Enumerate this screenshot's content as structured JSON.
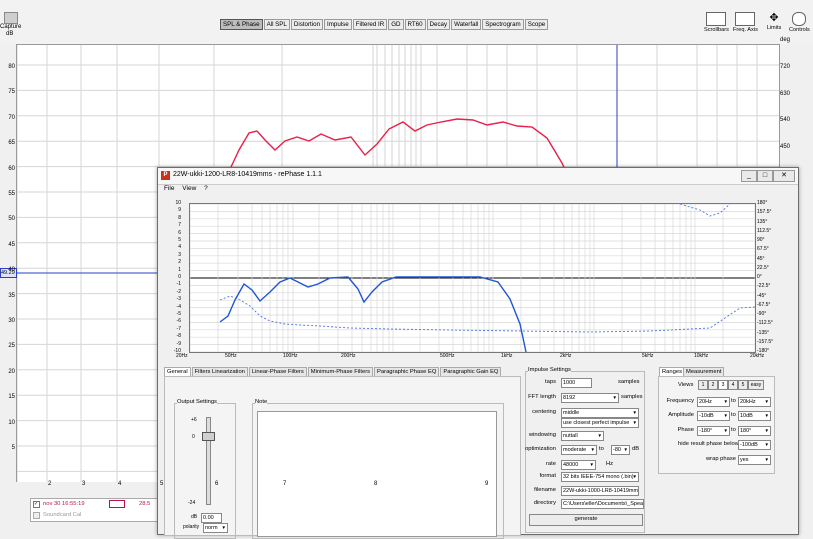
{
  "rew": {
    "capture_label": "Capture",
    "left_unit": "dB",
    "right_unit": "deg",
    "tabs": [
      "SPL & Phase",
      "All SPL",
      "Distortion",
      "Impulse",
      "Filtered IR",
      "GD",
      "RT60",
      "Decay",
      "Waterfall",
      "Spectrogram",
      "Scope"
    ],
    "active_tab": "SPL & Phase",
    "tools": [
      "Scrollbars",
      "Freq. Axis",
      "Limits",
      "Controls"
    ],
    "y_left_ticks": [
      "80",
      "75",
      "70",
      "65",
      "60",
      "55",
      "50",
      "45",
      "40",
      "35",
      "30",
      "25",
      "20",
      "15",
      "10",
      "5"
    ],
    "y_right_ticks": [
      "720",
      "630",
      "540",
      "450"
    ],
    "x_ticks": [
      "2",
      "3",
      "4",
      "5",
      "6",
      "7",
      "8",
      "9"
    ],
    "cursor_value": "49.29",
    "legend": {
      "entry1": "nov 30 16:55:19",
      "entry1_value": "28.5",
      "entry2": "Soundcard Cal"
    },
    "colors": {
      "spl": "#e8204a",
      "cursor": "#2a3fc4"
    }
  },
  "rephase": {
    "title": "22W-ukki-1200-LR8-10419mms  -  rePhase 1.1.1",
    "icon_letter": "P",
    "menu": [
      "File",
      "View",
      "?"
    ],
    "plot": {
      "y_left": [
        "10",
        "9",
        "8",
        "7",
        "6",
        "5",
        "4",
        "3",
        "2",
        "1",
        "0",
        "-1",
        "-2",
        "-3",
        "-4",
        "-5",
        "-6",
        "-7",
        "-8",
        "-9",
        "-10"
      ],
      "y_right": [
        "180°",
        "157.5°",
        "135°",
        "112.5°",
        "90°",
        "67.5°",
        "45°",
        "22.5°",
        "0°",
        "-22.5°",
        "-45°",
        "-67.5°",
        "-90°",
        "-112.5°",
        "-135°",
        "-157.5°",
        "-180°"
      ],
      "x": [
        "20Hz",
        "50Hz",
        "100Hz",
        "200Hz",
        "500Hz",
        "1kHz",
        "2kHz",
        "5kHz",
        "10kHz",
        "20kHz"
      ],
      "colors": {
        "mag": "#1f56d6",
        "phase": "#4b74dd"
      }
    },
    "tabs": [
      "General",
      "Filters Linearization",
      "Linear-Phase Filters",
      "Minimum-Phase Filters",
      "Paragraphic Phase EQ",
      "Paragraphic Gain EQ"
    ],
    "output": {
      "label": "Output Settings",
      "scale_top": "+6",
      "scale_zero": "0",
      "scale_bottom": "-24",
      "db_label": "dB",
      "db_value": "0.00",
      "polarity_label": "polarity",
      "polarity_value": "norm"
    },
    "note_label": "Note",
    "impulse": {
      "title": "Impulse Settings",
      "taps_label": "taps",
      "taps_value": "1000",
      "taps_unit": "samples",
      "fft_label": "FFT length",
      "fft_value": "8192",
      "fft_unit": "samples",
      "centering_label": "centering",
      "centering_value1": "middle",
      "centering_value2": "use closest perfect impulse",
      "windowing_label": "windowing",
      "windowing_value": "nuttall",
      "opt_label": "optimization",
      "opt_value": "moderate",
      "opt_to": "to",
      "opt_db_value": "-80",
      "opt_unit": "dB",
      "rate_label": "rate",
      "rate_value": "48000",
      "rate_unit": "Hz",
      "format_label": "format",
      "format_value": "32 bits IEEE-754 mono (.bin)",
      "filename_label": "filename",
      "filename_value": "22W-ukki-1000-LR8-10419mms",
      "directory_label": "directory",
      "directory_value": "C:\\Users\\eller\\Documents\\_Spea",
      "generate_label": "generate"
    },
    "ranges": {
      "tab1": "Ranges",
      "tab2": "Measurement",
      "views_label": "Views",
      "views": [
        "1",
        "2",
        "3",
        "4",
        "5",
        "easy"
      ],
      "freq_label": "Frequency",
      "freq_from": "20Hz",
      "freq_to_label": "to",
      "freq_to": "20kHz",
      "amp_label": "Amplitude",
      "amp_from": "-10dB",
      "amp_to_label": "to",
      "amp_to": "10dB",
      "phase_label": "Phase",
      "phase_from": "-180°",
      "phase_to_label": "to",
      "phase_to": "180°",
      "hide_label": "hide result phase below",
      "hide_value": "-100dB",
      "wrap_label": "wrap phase",
      "wrap_value": "yes"
    },
    "controls": {
      "minimize": "_",
      "maximize": "□",
      "close": "✕"
    }
  }
}
